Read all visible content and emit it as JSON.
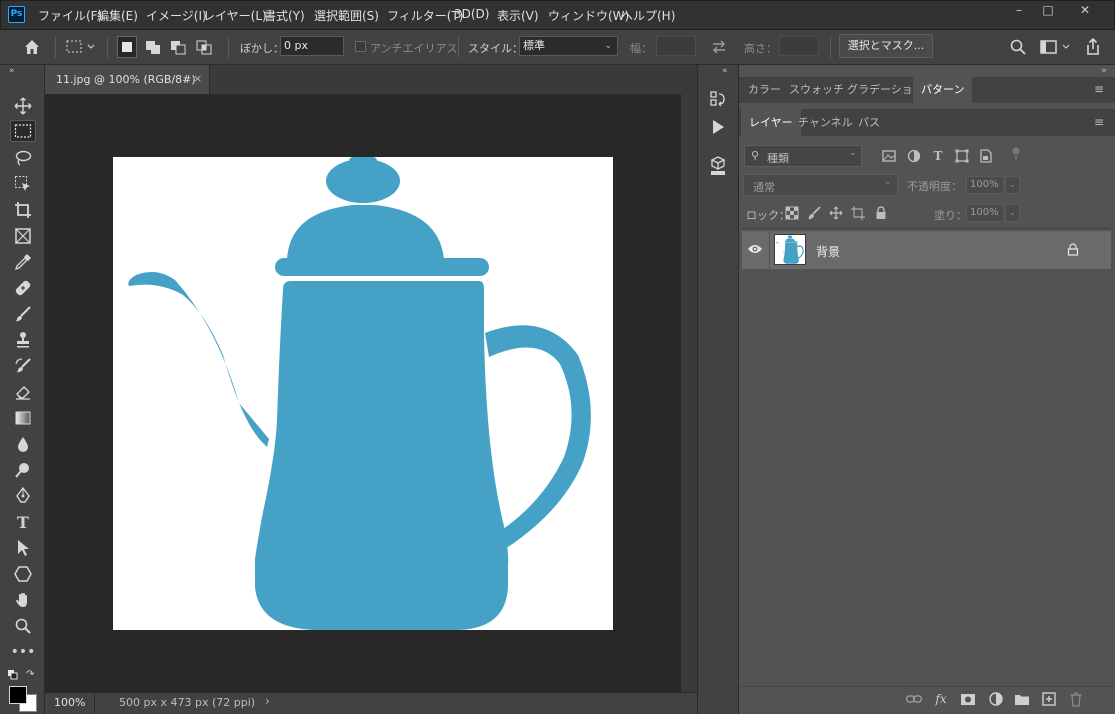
{
  "app": {
    "logo": "Ps",
    "menu": [
      "ファイル(F)",
      "編集(E)",
      "イメージ(I)",
      "レイヤー(L)",
      "書式(Y)",
      "選択範囲(S)",
      "フィルター(T)",
      "3D(D)",
      "表示(V)",
      "ウィンドウ(W)",
      "ヘルプ(H)"
    ]
  },
  "options": {
    "feather_label": "ぼかし：",
    "feather_value": "0 px",
    "antialias_label": "アンチエイリアス",
    "style_label": "スタイル：",
    "style_value": "標準",
    "width_label": "幅：",
    "height_label": "高さ：",
    "select_mask_button": "選択とマスク..."
  },
  "document": {
    "tab_title": "11.jpg @ 100% (RGB/8#)",
    "zoom": "100%",
    "info": "500 px x 473 px (72 ppi)"
  },
  "panels": {
    "top_tabs": [
      "カラー",
      "スウォッチ",
      "グラデーション",
      "パターン"
    ],
    "top_active": "パターン",
    "layer_tabs": [
      "レイヤー",
      "チャンネル",
      "パス"
    ],
    "layer_active": "レイヤー",
    "filter_placeholder": "種類",
    "blend_mode": "通常",
    "opacity_label": "不透明度：",
    "opacity_value": "100%",
    "lock_label": "ロック：",
    "fill_label": "塗り：",
    "fill_value": "100%",
    "layer_name": "背景"
  },
  "colors": {
    "teapot": "#45a2c6",
    "foreground": "#000000",
    "background": "#ffffff"
  }
}
